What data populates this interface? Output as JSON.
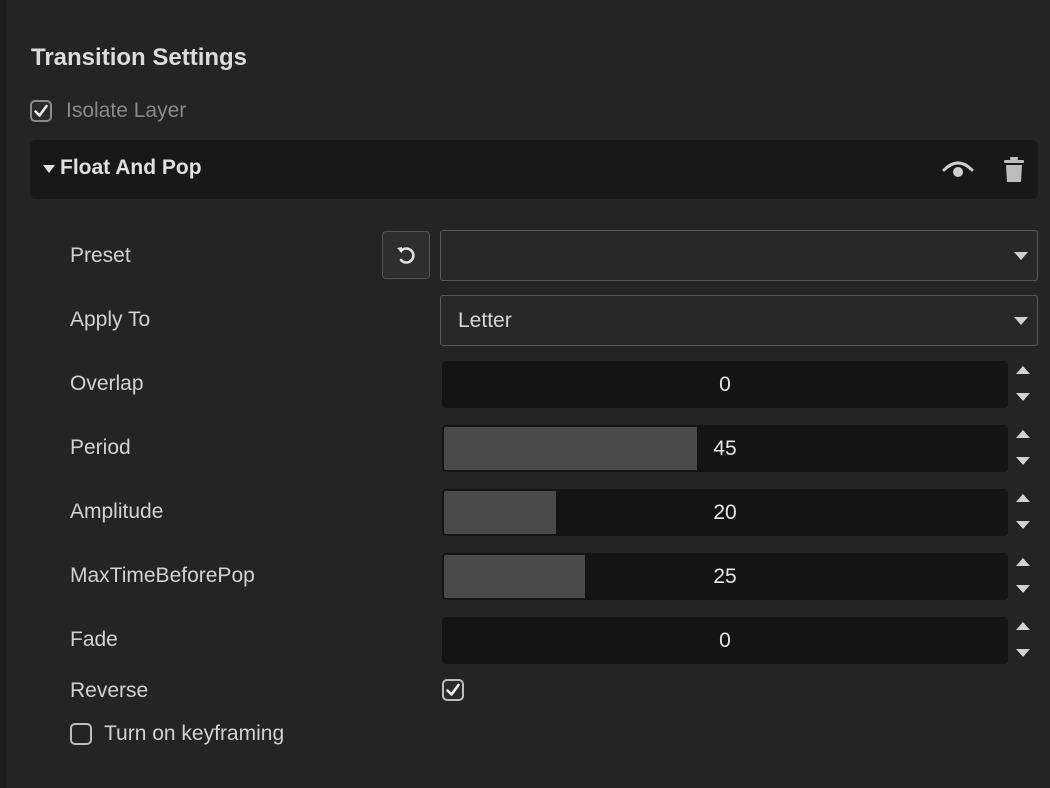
{
  "panel": {
    "title": "Transition Settings",
    "isolate_layer": {
      "label": "Isolate Layer",
      "checked": true
    }
  },
  "section": {
    "title": "Float And Pop",
    "icons": [
      "eye-icon",
      "trash-icon"
    ]
  },
  "fields": {
    "preset": {
      "label": "Preset",
      "value": "",
      "reset_icon": "undo-icon"
    },
    "apply_to": {
      "label": "Apply To",
      "value": "Letter"
    },
    "overlap": {
      "label": "Overlap",
      "value": "0",
      "fill_fraction": 0
    },
    "period": {
      "label": "Period",
      "value": "45",
      "fill_fraction": 0.45
    },
    "amplitude": {
      "label": "Amplitude",
      "value": "20",
      "fill_fraction": 0.2
    },
    "max_time_before_pop": {
      "label": "MaxTimeBeforePop",
      "value": "25",
      "fill_fraction": 0.25
    },
    "fade": {
      "label": "Fade",
      "value": "0",
      "fill_fraction": 0
    },
    "reverse": {
      "label": "Reverse",
      "checked": true
    }
  },
  "keyframing": {
    "label": "Turn on keyframing",
    "checked": false
  },
  "colors": {
    "background": "#242424",
    "header": "#181818",
    "field": "#141414",
    "fill": "#4a4a4a",
    "text": "#d2d2d2"
  }
}
